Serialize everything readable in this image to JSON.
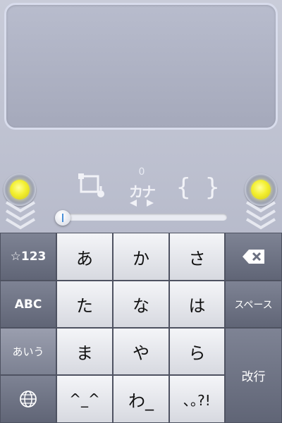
{
  "toolbar": {
    "count": "0",
    "kana_toggle_label": "カナ",
    "braces_label": "{ }"
  },
  "keyboard": {
    "left_keys": [
      "☆123",
      "ABC",
      "あいう",
      "globe"
    ],
    "main_keys": [
      [
        "あ",
        "か",
        "さ"
      ],
      [
        "た",
        "な",
        "は"
      ],
      [
        "ま",
        "や",
        "ら"
      ],
      [
        "^_^",
        "わ_",
        "､｡?!"
      ]
    ],
    "backspace": "backspace",
    "space_label": "スペース",
    "return_label": "改行"
  },
  "colors": {
    "lamp": "#f3ef30",
    "key_light": "#e8e9ee",
    "key_dark": "#6e7384"
  }
}
